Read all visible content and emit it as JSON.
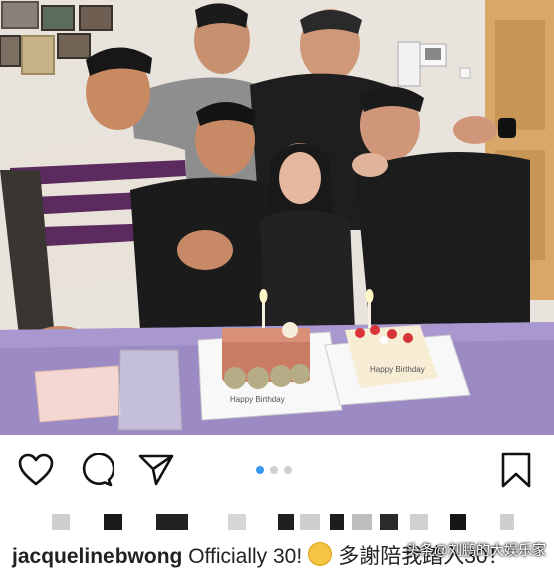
{
  "post": {
    "username": "jacquelinebwong",
    "caption_en": "Officially 30!",
    "caption_zh": "多謝陪我踏入30！",
    "emoji": "smiling-face-icon"
  },
  "actions": {
    "like_icon": "heart-icon",
    "comment_icon": "comment-icon",
    "share_icon": "paper-plane-icon",
    "save_icon": "bookmark-icon",
    "carousel_dots": 3,
    "active_dot": 0
  },
  "photo": {
    "cake_left_text": "Happy Birthday",
    "cake_right_text": "Happy Birthday"
  },
  "watermark": "头条@刘鹏的大娱乐家",
  "colors": {
    "accent_blue": "#3897f0",
    "table_purple": "#9b8ac4"
  }
}
